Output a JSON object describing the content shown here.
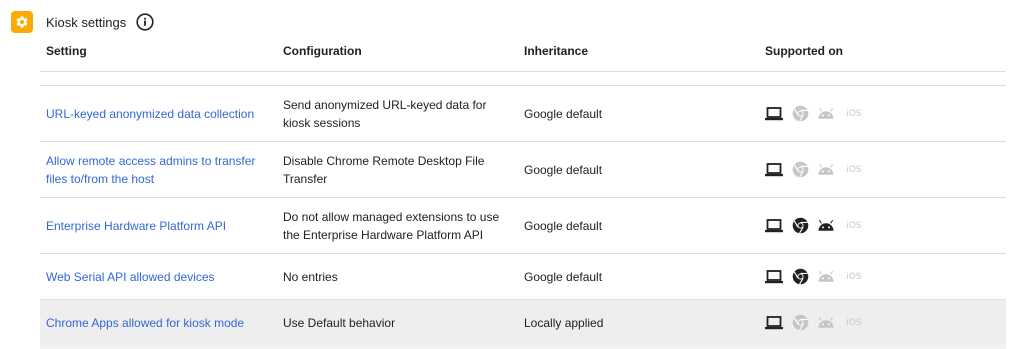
{
  "header": {
    "title": "Kiosk settings",
    "accent_color": "#f9ab00"
  },
  "table": {
    "columns": [
      "Setting",
      "Configuration",
      "Inheritance",
      "Supported on"
    ],
    "rows": [
      {
        "setting_line1": "URL-keyed anonymized data collection",
        "setting_line2": "",
        "config_line1": "Send anonymized URL-keyed data for",
        "config_line2": "kiosk sessions",
        "inheritance": "Google default",
        "supported": {
          "laptop": true,
          "chrome": false,
          "android": false,
          "ios": false
        }
      },
      {
        "setting_line1": "Allow remote access admins to transfer",
        "setting_line2": "files to/from the host",
        "config_line1": "Disable Chrome Remote Desktop File",
        "config_line2": "Transfer",
        "inheritance": "Google default",
        "supported": {
          "laptop": true,
          "chrome": false,
          "android": false,
          "ios": false
        }
      },
      {
        "setting_line1": "Enterprise Hardware Platform API",
        "setting_line2": "",
        "config_line1": "Do not allow managed extensions to use",
        "config_line2": "the Enterprise Hardware Platform API",
        "inheritance": "Google default",
        "supported": {
          "laptop": true,
          "chrome": true,
          "android": true,
          "ios": false
        }
      },
      {
        "setting_line1": "Web Serial API allowed devices",
        "setting_line2": "",
        "config_line1": "No entries",
        "config_line2": "",
        "inheritance": "Google default",
        "supported": {
          "laptop": true,
          "chrome": true,
          "android": false,
          "ios": false
        }
      },
      {
        "setting_line1": "Chrome Apps allowed for kiosk mode",
        "setting_line2": "",
        "config_line1": "Use Default behavior",
        "config_line2": "",
        "inheritance": "Locally applied",
        "supported": {
          "laptop": true,
          "chrome": false,
          "android": false,
          "ios": false
        }
      }
    ],
    "ios_label": "iOS"
  },
  "colors": {
    "link": "#3367d6",
    "icon_active": "#202124",
    "icon_inactive": "#c4c7c9",
    "row_highlight": "#eeeeee"
  }
}
